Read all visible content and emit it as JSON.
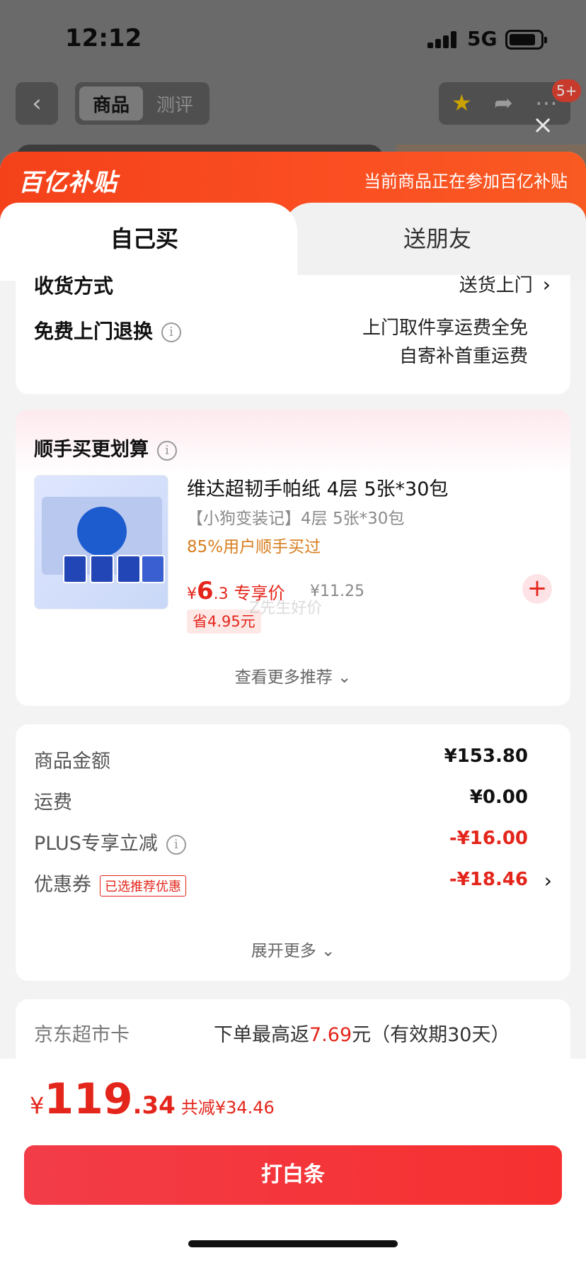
{
  "status_bar": {
    "time": "12:12",
    "network": "5G"
  },
  "nav": {
    "back_icon": "chevron-left-icon",
    "tab_active": "商品",
    "tab_inactive": "测评",
    "badge": "5+"
  },
  "sheet": {
    "brand": "百亿补贴",
    "head_tip": "当前商品正在参加百亿补贴",
    "tabs": {
      "self": "自己买",
      "friend": "送朋友"
    }
  },
  "delivery": {
    "method_label": "收货方式",
    "method_value": "送货上门",
    "return_label": "免费上门退换",
    "return_value_1": "上门取件享运费全免",
    "return_value_2": "自寄补首重运费"
  },
  "addon": {
    "title": "顺手买更划算",
    "product": {
      "name": "维达超韧手帕纸 4层 5张*30包",
      "sub": "【小狗变装记】4层 5张*30包",
      "tag": "85%用户顺手买过",
      "price_currency": "¥",
      "price_int": "6",
      "price_dec": ".3",
      "price_label": "专享价",
      "original_price": "¥11.25",
      "save": "省4.95元"
    },
    "watermark": "Z先生好价",
    "more": "查看更多推荐 ⌄"
  },
  "fees": {
    "rows": [
      {
        "label": "商品金额",
        "value": "¥153.80"
      },
      {
        "label": "运费",
        "value": "¥0.00"
      },
      {
        "label": "PLUS专享立减",
        "value": "-¥16.00"
      },
      {
        "label": "优惠券",
        "value": "-¥18.46",
        "tag": "已选推荐优惠"
      }
    ],
    "expand": "展开更多 ⌄"
  },
  "card": {
    "label": "京东超市卡",
    "text_pre": "下单最高返",
    "text_highlight": "7.69",
    "text_post": "元（有效期30天）"
  },
  "footer": {
    "currency": "¥",
    "total_int": "119",
    "total_dec": ".34",
    "reduction": "共减¥34.46",
    "pay_button": "打白条"
  },
  "colors": {
    "accent": "#e4251b",
    "brand_orange": "#f84a1f"
  }
}
